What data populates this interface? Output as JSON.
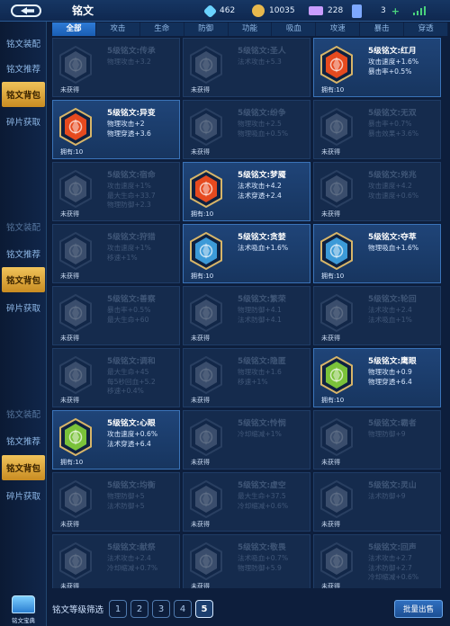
{
  "header": {
    "title": "铭文",
    "resources": [
      {
        "icon": "gem-crystal-icon",
        "value": "462",
        "color": "#6ad3ff"
      },
      {
        "icon": "gold-coin-icon",
        "value": "10035",
        "color": "#e7b84d"
      },
      {
        "icon": "diamond-icon",
        "value": "228",
        "color": "#c99dff"
      },
      {
        "icon": "ticket-card-icon",
        "value": "3",
        "color": "#7da8ff"
      }
    ],
    "plus_symbol": "+"
  },
  "sidebar": {
    "groups": [
      {
        "items": [
          {
            "label": "铭文装配",
            "active": false
          },
          {
            "label": "铭文推荐",
            "active": false
          },
          {
            "label": "铭文背包",
            "active": true
          },
          {
            "label": "碎片获取",
            "active": false
          }
        ]
      },
      {
        "items": [
          {
            "label": "铭文装配",
            "active": false
          },
          {
            "label": "铭文推荐",
            "active": false
          },
          {
            "label": "铭文背包",
            "active": true
          },
          {
            "label": "碎片获取",
            "active": false
          }
        ]
      },
      {
        "items": [
          {
            "label": "铭文装配",
            "active": false
          },
          {
            "label": "铭文推荐",
            "active": false
          },
          {
            "label": "铭文背包",
            "active": true
          },
          {
            "label": "碎片获取",
            "active": false
          }
        ]
      }
    ],
    "logo_label": "铭文宝典"
  },
  "tabs": [
    "全部",
    "攻击",
    "生命",
    "防御",
    "功能",
    "吸血",
    "攻速",
    "暴击",
    "穿透"
  ],
  "active_tab": 0,
  "cards": [
    {
      "name": "5级铭文:传承",
      "stats": [
        "物理攻击+3.2"
      ],
      "owned": "未获得",
      "color": "#7f8ea6",
      "dim": true
    },
    {
      "name": "5级铭文:圣人",
      "stats": [
        "法术攻击+5.3"
      ],
      "owned": "未获得",
      "color": "#7f8ea6",
      "dim": true
    },
    {
      "name": "5级铭文:红月",
      "stats": [
        "攻击速度+1.6%",
        "暴击率+0.5%"
      ],
      "owned": "拥有:10",
      "color": "#e64a1f",
      "dim": false
    },
    {
      "name": "5级铭文:异变",
      "stats": [
        "物理攻击+2",
        "物理穿透+3.6"
      ],
      "owned": "拥有:10",
      "color": "#e64a1f",
      "dim": false
    },
    {
      "name": "5级铭文:纷争",
      "stats": [
        "物理攻击+2.5",
        "物理吸血+0.5%"
      ],
      "owned": "未获得",
      "color": "#7f8ea6",
      "dim": true
    },
    {
      "name": "5级铭文:无双",
      "stats": [
        "暴击率+0.7%",
        "暴击效果+3.6%"
      ],
      "owned": "未获得",
      "color": "#7f8ea6",
      "dim": true
    },
    {
      "name": "5级铭文:宿命",
      "stats": [
        "攻击速度+1%",
        "最大生命+33.7",
        "物理防御+2.3"
      ],
      "owned": "未获得",
      "color": "#7f8ea6",
      "dim": true
    },
    {
      "name": "5级铭文:梦魇",
      "stats": [
        "法术攻击+4.2",
        "法术穿透+2.4"
      ],
      "owned": "拥有:10",
      "color": "#e64a1f",
      "dim": false
    },
    {
      "name": "5级铭文:兇兆",
      "stats": [
        "攻击速度+4.2",
        "攻击速度+0.6%"
      ],
      "owned": "未获得",
      "color": "#7f8ea6",
      "dim": true
    },
    {
      "name": "5级铭文:狩猎",
      "stats": [
        "攻击速度+1%",
        "移速+1%"
      ],
      "owned": "未获得",
      "color": "#7f8ea6",
      "dim": true
    },
    {
      "name": "5级铭文:贪婪",
      "stats": [
        "法术吸血+1.6%"
      ],
      "owned": "拥有:10",
      "color": "#3c9ad8",
      "dim": false
    },
    {
      "name": "5级铭文:夺萃",
      "stats": [
        "物理吸血+1.6%"
      ],
      "owned": "拥有:10",
      "color": "#3c9ad8",
      "dim": false
    },
    {
      "name": "5级铭文:善察",
      "stats": [
        "暴击率+0.5%",
        "最大生命+60"
      ],
      "owned": "未获得",
      "color": "#7f8ea6",
      "dim": true
    },
    {
      "name": "5级铭文:繁荣",
      "stats": [
        "物理防御+4.1",
        "法术防御+4.1"
      ],
      "owned": "未获得",
      "color": "#7f8ea6",
      "dim": true
    },
    {
      "name": "5级铭文:轮回",
      "stats": [
        "法术攻击+2.4",
        "法术吸血+1%"
      ],
      "owned": "未获得",
      "color": "#7f8ea6",
      "dim": true
    },
    {
      "name": "5级铭文:调和",
      "stats": [
        "最大生命+45",
        "每5秒回血+5.2",
        "移速+0.4%"
      ],
      "owned": "未获得",
      "color": "#7f8ea6",
      "dim": true
    },
    {
      "name": "5级铭文:隐匿",
      "stats": [
        "物理攻击+1.6",
        "移速+1%"
      ],
      "owned": "未获得",
      "color": "#7f8ea6",
      "dim": true
    },
    {
      "name": "5级铭文:鹰眼",
      "stats": [
        "物理攻击+0.9",
        "物理穿透+6.4"
      ],
      "owned": "拥有:10",
      "color": "#7ac23a",
      "dim": false
    },
    {
      "name": "5级铭文:心眼",
      "stats": [
        "攻击速度+0.6%",
        "法术穿透+6.4"
      ],
      "owned": "拥有:10",
      "color": "#7ac23a",
      "dim": false
    },
    {
      "name": "5级铭文:怜悯",
      "stats": [
        "冷却缩减+1%"
      ],
      "owned": "未获得",
      "color": "#7f8ea6",
      "dim": true
    },
    {
      "name": "5级铭文:霸者",
      "stats": [
        "物理防御+9"
      ],
      "owned": "未获得",
      "color": "#7f8ea6",
      "dim": true
    },
    {
      "name": "5级铭文:均衡",
      "stats": [
        "物理防御+5",
        "法术防御+5"
      ],
      "owned": "未获得",
      "color": "#7f8ea6",
      "dim": true
    },
    {
      "name": "5级铭文:虚空",
      "stats": [
        "最大生命+37.5",
        "冷却缩减+0.6%"
      ],
      "owned": "未获得",
      "color": "#7f8ea6",
      "dim": true
    },
    {
      "name": "5级铭文:灵山",
      "stats": [
        "法术防御+9"
      ],
      "owned": "未获得",
      "color": "#7f8ea6",
      "dim": true
    },
    {
      "name": "5级铭文:献祭",
      "stats": [
        "法术攻击+2.4",
        "冷却缩减+0.7%"
      ],
      "owned": "未获得",
      "color": "#7f8ea6",
      "dim": true
    },
    {
      "name": "5级铭文:敬畏",
      "stats": [
        "法术吸血+0.7%",
        "物理防御+5.9"
      ],
      "owned": "未获得",
      "color": "#7f8ea6",
      "dim": true
    },
    {
      "name": "5级铭文:回声",
      "stats": [
        "法术攻击+2.7",
        "法术防御+2.7",
        "冷却缩减+0.6%"
      ],
      "owned": "未获得",
      "color": "#7f8ea6",
      "dim": true
    }
  ],
  "footer": {
    "filter_label": "铭文等级筛选",
    "levels": [
      "1",
      "2",
      "3",
      "4",
      "5"
    ],
    "active_level": 4,
    "sell_label": "批量出售"
  }
}
